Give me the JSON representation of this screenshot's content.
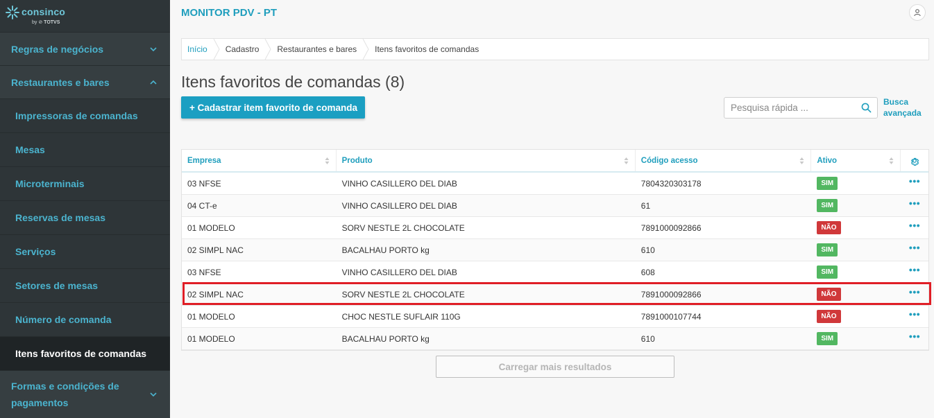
{
  "brand": {
    "name": "consinco",
    "sub_by": "by",
    "sub_brand": "TOTVS"
  },
  "sidebar": {
    "groups": [
      {
        "label": "Regras de negócios"
      },
      {
        "label": "Restaurantes e bares"
      }
    ],
    "items": [
      {
        "label": "Impressoras de comandas"
      },
      {
        "label": "Mesas"
      },
      {
        "label": "Microterminais"
      },
      {
        "label": "Reservas de mesas"
      },
      {
        "label": "Serviços"
      },
      {
        "label": "Setores de mesas"
      },
      {
        "label": "Número de comanda"
      },
      {
        "label": "Itens favoritos de comandas"
      }
    ],
    "bottom_group": {
      "line1": "Formas e condições de",
      "line2": "pagamentos"
    }
  },
  "header": {
    "title": "MONITOR PDV - PT"
  },
  "breadcrumb": [
    "Início",
    "Cadastro",
    "Restaurantes e bares",
    "Itens favoritos de comandas"
  ],
  "page": {
    "title": "Itens favoritos de comandas (8)",
    "add_button": "+ Cadastrar item favorito de comanda",
    "search_placeholder": "Pesquisa rápida ...",
    "advanced_line1": "Busca",
    "advanced_line2": "avançada"
  },
  "table": {
    "columns": [
      "Empresa",
      "Produto",
      "Código acesso",
      "Ativo"
    ],
    "rows": [
      {
        "empresa": "03 NFSE",
        "produto": "VINHO CASILLERO DEL DIAB",
        "codigo": "7804320303178",
        "ativo": "SIM"
      },
      {
        "empresa": "04 CT-e",
        "produto": "VINHO CASILLERO DEL DIAB",
        "codigo": "61",
        "ativo": "SIM"
      },
      {
        "empresa": "01 MODELO",
        "produto": "SORV NESTLE 2L CHOCOLATE",
        "codigo": "7891000092866",
        "ativo": "NÃO"
      },
      {
        "empresa": "02 SIMPL NAC",
        "produto": "BACALHAU PORTO kg",
        "codigo": "610",
        "ativo": "SIM"
      },
      {
        "empresa": "03 NFSE",
        "produto": "VINHO CASILLERO DEL DIAB",
        "codigo": "608",
        "ativo": "SIM"
      },
      {
        "empresa": "02 SIMPL NAC",
        "produto": "SORV NESTLE 2L CHOCOLATE",
        "codigo": "7891000092866",
        "ativo": "NÃO"
      },
      {
        "empresa": "01 MODELO",
        "produto": "CHOC NESTLE SUFLAIR 110G",
        "codigo": "7891000107744",
        "ativo": "NÃO"
      },
      {
        "empresa": "01 MODELO",
        "produto": "BACALHAU PORTO kg",
        "codigo": "610",
        "ativo": "SIM"
      }
    ],
    "row_action": "•••",
    "load_more": "Carregar mais resultados"
  },
  "colors": {
    "accent": "#1f9ebd",
    "sim": "#52b761",
    "nao": "#d0383a",
    "highlight": "#e01e26",
    "sidebar_bg": "#2e3538"
  },
  "icons": {
    "logo": "consinco-star-icon",
    "user": "user-icon",
    "search": "search-icon",
    "settings": "gear-icon",
    "chevron": "chevron-icon",
    "sort": "sort-icon"
  }
}
